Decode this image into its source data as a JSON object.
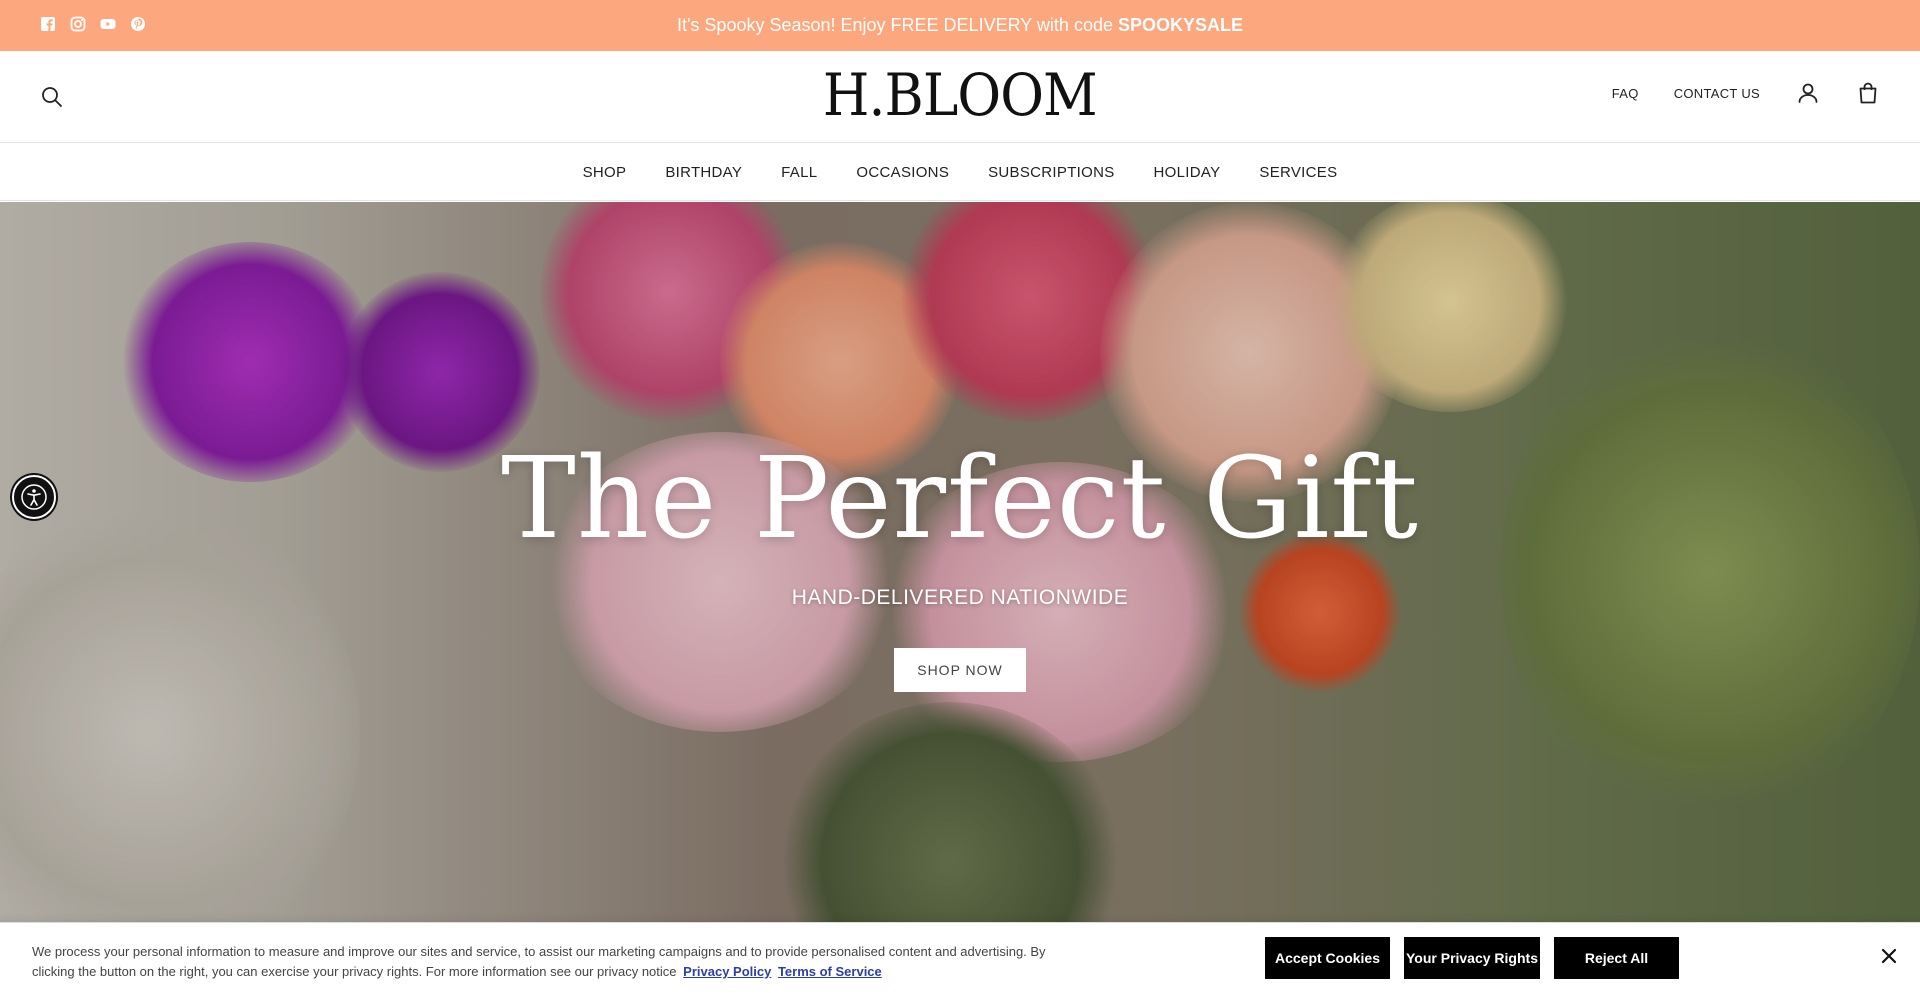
{
  "announcement": {
    "text": "It's Spooky Season! Enjoy FREE DELIVERY with code",
    "code": "SPOOKYSALE",
    "background": "#fca77d",
    "social_icons": [
      "facebook-icon",
      "instagram-icon",
      "youtube-icon",
      "pinterest-icon"
    ]
  },
  "header": {
    "logo": "H.BLOOM",
    "faq": "FAQ",
    "contact": "CONTACT US",
    "icons": [
      "search-icon",
      "account-icon",
      "cart-icon"
    ]
  },
  "nav": {
    "items": [
      "SHOP",
      "BIRTHDAY",
      "FALL",
      "OCCASIONS",
      "SUBSCRIPTIONS",
      "HOLIDAY",
      "SERVICES"
    ]
  },
  "hero": {
    "title": "The Perfect Gift",
    "subtitle": "HAND-DELIVERED NATIONWIDE",
    "cta": "SHOP NOW"
  },
  "accessibility": {
    "icon": "accessibility-icon"
  },
  "cookie": {
    "text": "We process your personal information to measure and improve our sites and service, to assist our marketing campaigns and to provide personalised content and advertising. By clicking the button on the right, you can exercise your privacy rights. For more information see our privacy notice",
    "privacy_link": "Privacy Policy",
    "terms_link": "Terms of Service",
    "accept": "Accept Cookies",
    "privacy_rights": "Your Privacy Rights",
    "reject": "Reject All",
    "close_icon": "close-icon"
  }
}
